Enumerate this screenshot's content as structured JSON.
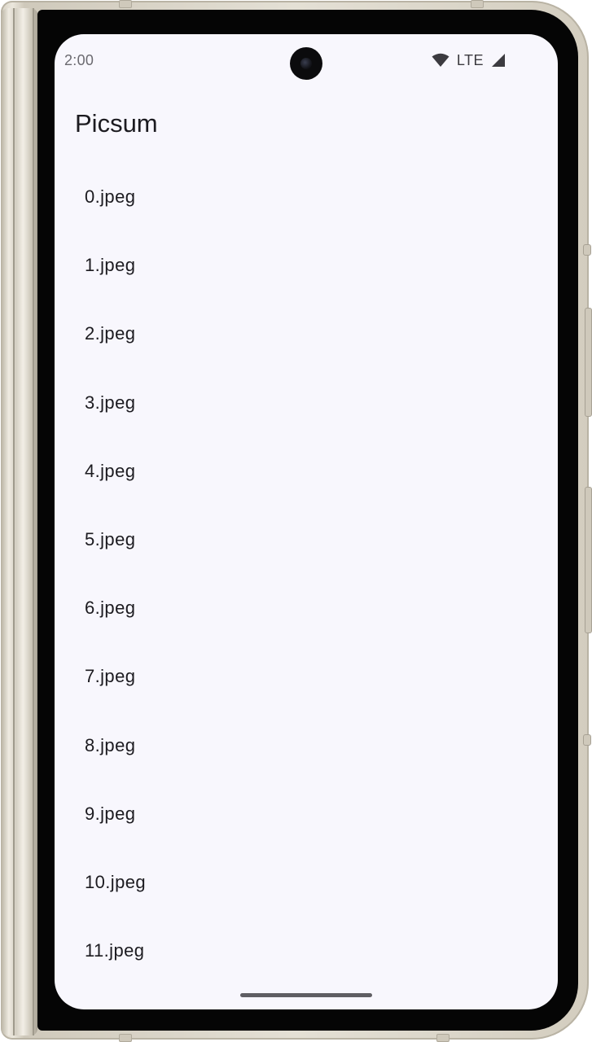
{
  "status_bar": {
    "time": "2:00",
    "network": "LTE",
    "icons": [
      "wifi-icon",
      "cell-signal-icon"
    ]
  },
  "app": {
    "title": "Picsum"
  },
  "files": [
    "0.jpeg",
    "1.jpeg",
    "2.jpeg",
    "3.jpeg",
    "4.jpeg",
    "5.jpeg",
    "6.jpeg",
    "7.jpeg",
    "8.jpeg",
    "9.jpeg",
    "10.jpeg",
    "11.jpeg"
  ],
  "colors": {
    "screen_background": "#f8f7fd",
    "text_primary": "#1c1b20",
    "status_text": "#6b6a70"
  }
}
